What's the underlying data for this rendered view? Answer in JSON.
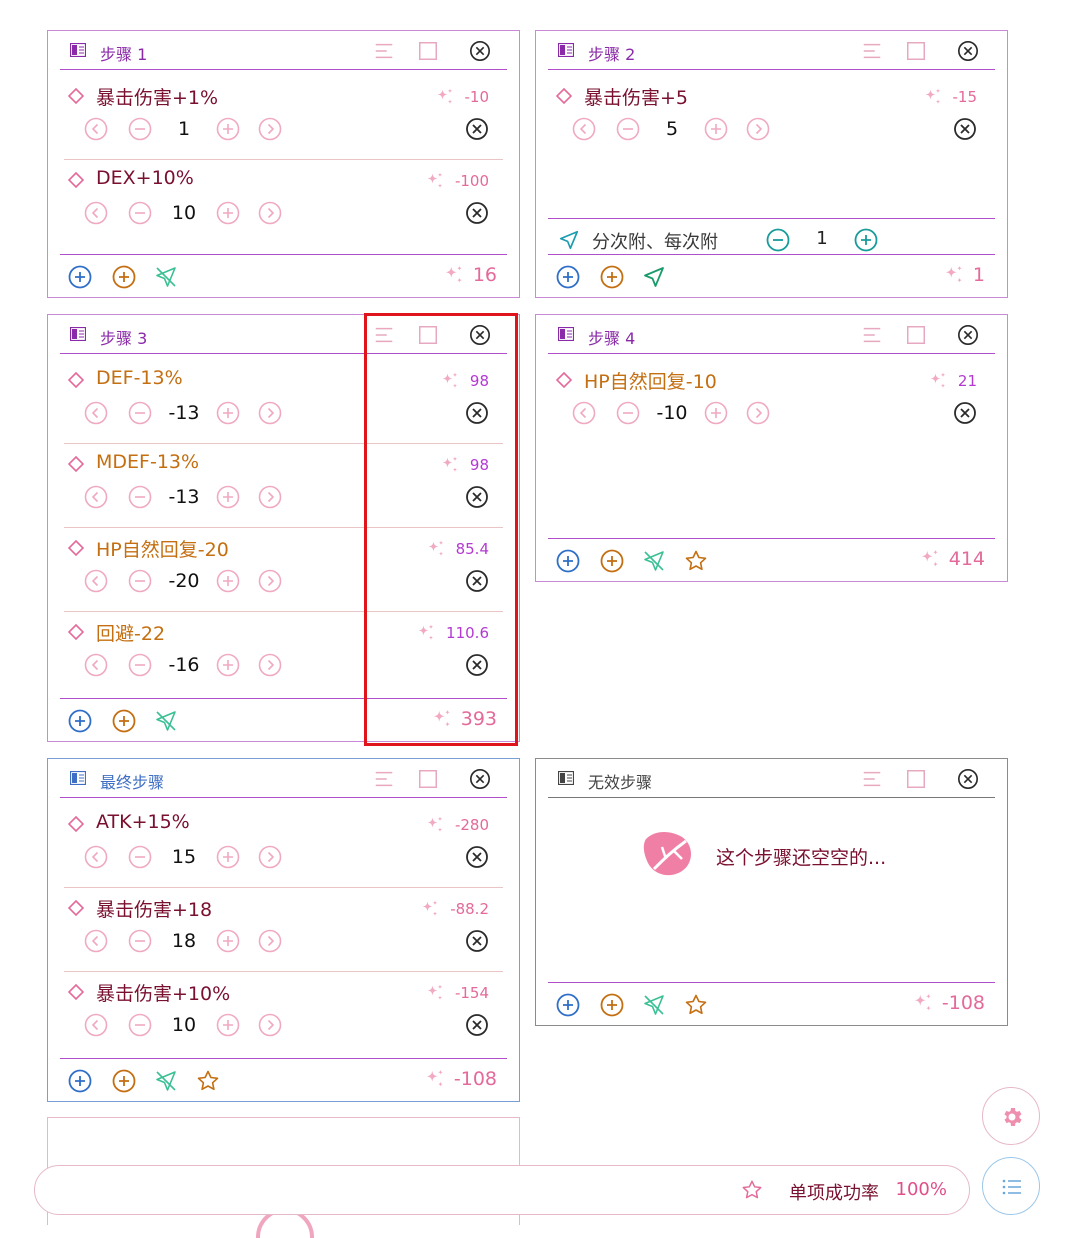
{
  "colors": {
    "purple": "#b33ad1",
    "pink": "#e36a9a",
    "dark_red": "#7a1030",
    "orange": "#c46f12",
    "blue": "#2f6fc7",
    "teal": "#1a9b9b",
    "green": "#1a9b6b",
    "highlight_red": "#e0141b"
  },
  "steps": [
    {
      "title": "步骤 1",
      "items": [
        {
          "name": "暴击伤害+1%",
          "cost": "-10",
          "value": "1"
        },
        {
          "name": "DEX+10%",
          "cost": "-100",
          "value": "10"
        }
      ],
      "total": "16"
    },
    {
      "title": "步骤 2",
      "items": [
        {
          "name": "暴击伤害+5",
          "cost": "-15",
          "value": "5"
        }
      ],
      "attach": {
        "label": "分次附、每次附",
        "value": "1"
      },
      "total": "1"
    },
    {
      "title": "步骤 3",
      "items": [
        {
          "name": "DEF-13%",
          "cost": "98",
          "value": "-13"
        },
        {
          "name": "MDEF-13%",
          "cost": "98",
          "value": "-13"
        },
        {
          "name": "HP自然回复-20",
          "cost": "85.4",
          "value": "-20"
        },
        {
          "name": "回避-22",
          "cost": "110.6",
          "value": "-16"
        }
      ],
      "total": "393"
    },
    {
      "title": "步骤 4",
      "items": [
        {
          "name": "HP自然回复-10",
          "cost": "21",
          "value": "-10"
        }
      ],
      "total": "414"
    },
    {
      "title": "最终步骤",
      "items": [
        {
          "name": "ATK+15%",
          "cost": "-280",
          "value": "15"
        },
        {
          "name": "暴击伤害+18",
          "cost": "-88.2",
          "value": "18"
        },
        {
          "name": "暴击伤害+10%",
          "cost": "-154",
          "value": "10"
        }
      ],
      "total": "-108"
    },
    {
      "title": "无效步骤",
      "items": [],
      "empty_message": "这个步骤还空空的...",
      "total": "-108"
    }
  ],
  "bottom_bar": {
    "rate_label": "单项成功率",
    "rate_value": "100%"
  },
  "icons": {
    "step": "book-icon",
    "list": "list-icon",
    "check": "checkbox-icon",
    "close": "close-circle-icon",
    "diamond": "diamond-icon",
    "sparkle": "sparkle-icon",
    "prev": "chevron-left-circle-icon",
    "next": "chevron-right-circle-icon",
    "minus": "minus-circle-icon",
    "plus": "plus-circle-icon",
    "send": "send-icon",
    "send_off": "send-off-icon",
    "star": "star-icon",
    "gear": "gear-icon",
    "menu": "menu-list-icon",
    "leaf": "leaf-icon"
  }
}
